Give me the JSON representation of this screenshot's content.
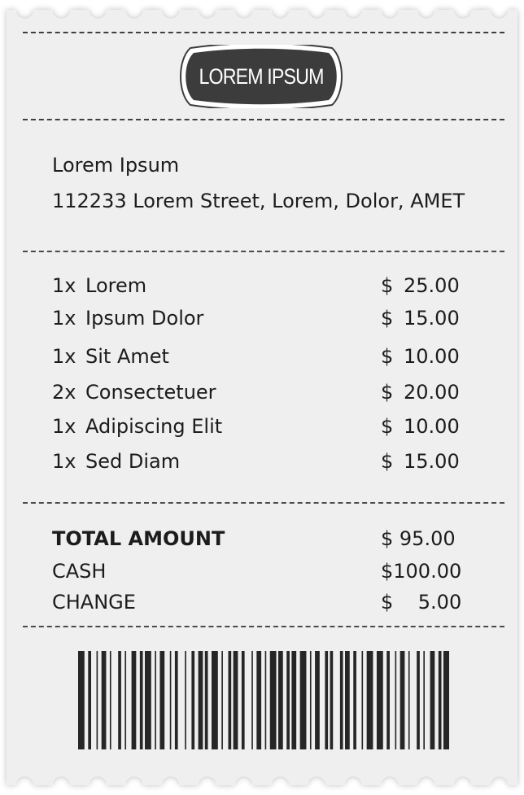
{
  "logo": {
    "text": "LOREM IPSUM"
  },
  "store": {
    "name": "Lorem Ipsum",
    "address": "112233 Lorem Street, Lorem, Dolor, AMET"
  },
  "items": [
    {
      "qty": "1x",
      "name": "Lorem",
      "currency": "$",
      "amount": "25.00"
    },
    {
      "qty": "1x",
      "name": "Ipsum Dolor",
      "currency": "$",
      "amount": "15.00"
    },
    {
      "qty": "1x",
      "name": "Sit Amet",
      "currency": "$",
      "amount": "10.00"
    },
    {
      "qty": "2x",
      "name": "Consectetuer",
      "currency": "$",
      "amount": "20.00"
    },
    {
      "qty": "1x",
      "name": "Adipiscing Elit",
      "currency": "$",
      "amount": "10.00"
    },
    {
      "qty": "1x",
      "name": "Sed Diam",
      "currency": "$",
      "amount": "15.00"
    }
  ],
  "totals": {
    "total_label": "TOTAL AMOUNT",
    "total_value": "$ 95.00",
    "cash_label": "CASH",
    "cash_value": "$100.00",
    "change_label": "CHANGE",
    "change_value": "$    5.00"
  },
  "colors": {
    "paper": "#efefef",
    "ink": "#1c1c1c",
    "logo_fill": "#3c3c3c"
  },
  "icons": {
    "logo": "logo-badge-icon",
    "barcode": "barcode-icon"
  }
}
